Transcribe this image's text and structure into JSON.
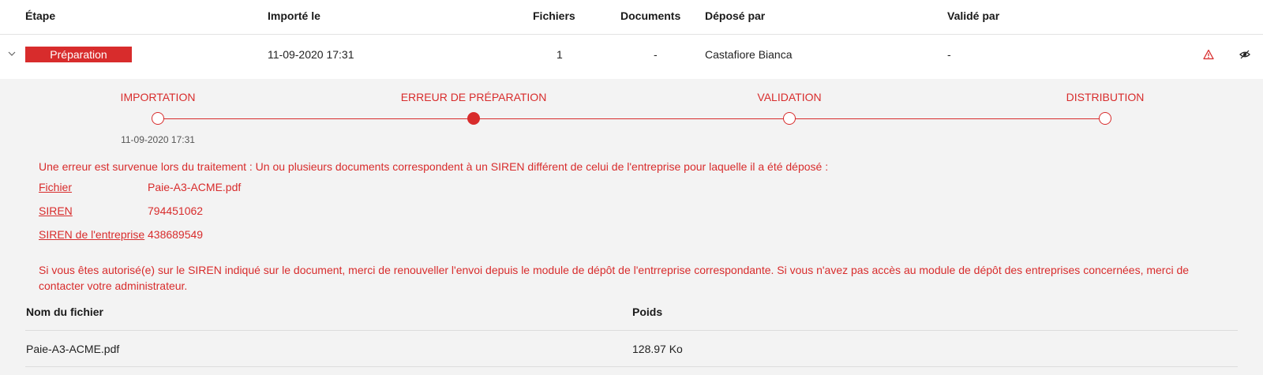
{
  "table": {
    "headers": {
      "etape": "Étape",
      "importe_le": "Importé le",
      "fichiers": "Fichiers",
      "documents": "Documents",
      "depose_par": "Déposé par",
      "valide_par": "Validé par"
    },
    "row": {
      "stage": "Préparation",
      "imported_at": "11-09-2020 17:31",
      "files": "1",
      "documents": "-",
      "deposited_by": "Castafiore Bianca",
      "validated_by": "-",
      "icons": [
        "chevron-down-icon",
        "warning-icon",
        "eye-icon"
      ]
    }
  },
  "timeline": {
    "steps": [
      {
        "label": "IMPORTATION",
        "state": "done"
      },
      {
        "label": "ERREUR DE PRÉPARATION",
        "state": "active"
      },
      {
        "label": "VALIDATION",
        "state": "pending"
      },
      {
        "label": "DISTRIBUTION",
        "state": "pending"
      }
    ],
    "first_date": "11-09-2020 17:31"
  },
  "error": {
    "title": "Une erreur est survenue lors du traitement : Un ou plusieurs documents correspondent à un SIREN différent de celui de l'entreprise pour laquelle il a été déposé :",
    "details": [
      {
        "key": "Fichier",
        "value": "Paie-A3-ACME.pdf"
      },
      {
        "key": "SIREN",
        "value": "794451062"
      },
      {
        "key": "SIREN de l'entreprise",
        "value": "438689549"
      }
    ],
    "note": "Si vous êtes autorisé(e) sur le SIREN indiqué sur le document, merci de renouveller l'envoi depuis le module de dépôt de l'entrreprise correspondante. Si vous n'avez pas accès au module de dépôt des entreprises concernées, merci de contacter votre administrateur."
  },
  "files_table": {
    "headers": {
      "name": "Nom du fichier",
      "size": "Poids"
    },
    "rows": [
      {
        "name": "Paie-A3-ACME.pdf",
        "size": "128.97 Ko"
      }
    ]
  },
  "colors": {
    "accent": "#d82c2c",
    "row_bg": "#ffffff",
    "panel_bg": "#f3f3f3"
  }
}
